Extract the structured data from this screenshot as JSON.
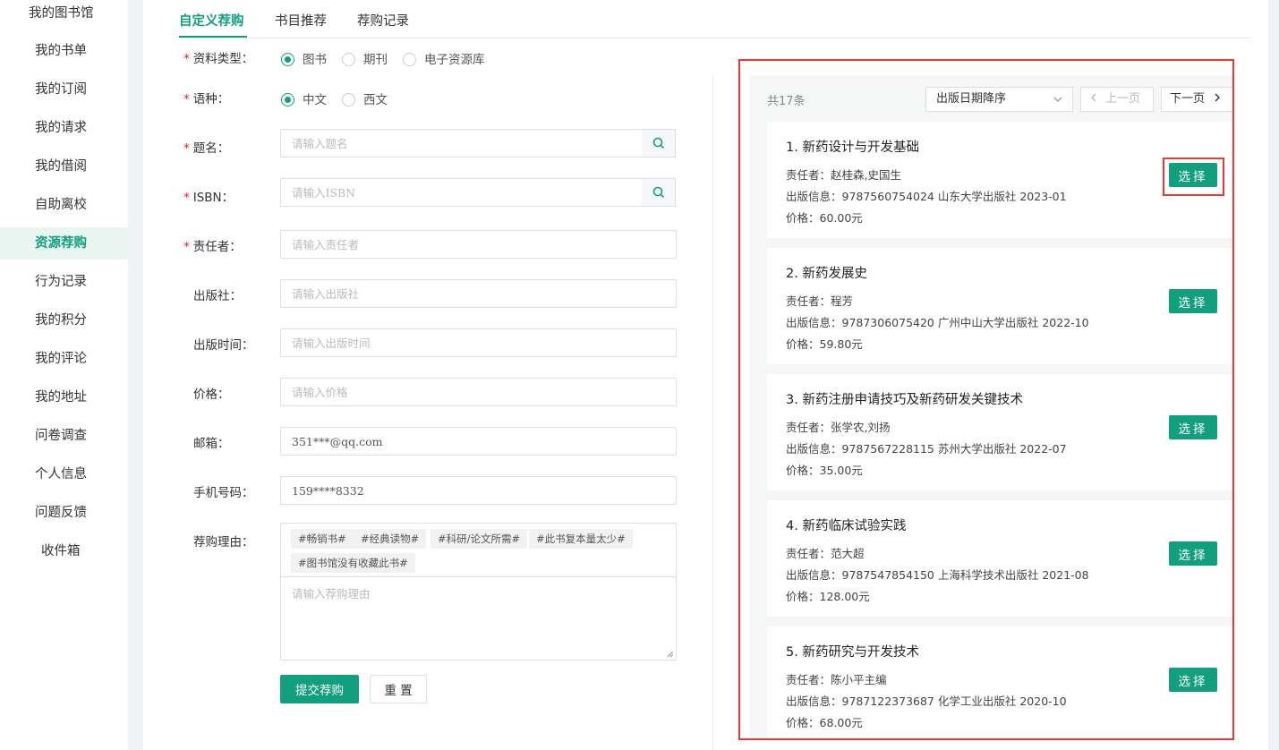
{
  "sidebar": {
    "items": [
      {
        "label": "我的图书馆",
        "active": false
      },
      {
        "label": "我的书单",
        "active": false
      },
      {
        "label": "我的订阅",
        "active": false
      },
      {
        "label": "我的请求",
        "active": false
      },
      {
        "label": "我的借阅",
        "active": false
      },
      {
        "label": "自助离校",
        "active": false
      },
      {
        "label": "资源荐购",
        "active": true
      },
      {
        "label": "行为记录",
        "active": false
      },
      {
        "label": "我的积分",
        "active": false
      },
      {
        "label": "我的评论",
        "active": false
      },
      {
        "label": "我的地址",
        "active": false
      },
      {
        "label": "问卷调查",
        "active": false
      },
      {
        "label": "个人信息",
        "active": false
      },
      {
        "label": "问题反馈",
        "active": false
      },
      {
        "label": "收件箱",
        "active": false
      }
    ]
  },
  "tabs": [
    {
      "label": "自定义荐购",
      "active": true
    },
    {
      "label": "书目推荐",
      "active": false
    },
    {
      "label": "荐购记录",
      "active": false
    }
  ],
  "form": {
    "material_type": {
      "label": "资料类型",
      "options": [
        "图书",
        "期刊",
        "电子资源库"
      ],
      "selected": "图书"
    },
    "language": {
      "label": "语种",
      "options": [
        "中文",
        "西文"
      ],
      "selected": "中文"
    },
    "title": {
      "label": "题名",
      "placeholder": "请输入题名",
      "value": ""
    },
    "isbn": {
      "label": "ISBN",
      "placeholder": "请输入ISBN",
      "value": ""
    },
    "author": {
      "label": "责任者",
      "placeholder": "请输入责任者",
      "value": ""
    },
    "publisher": {
      "label": "出版社",
      "placeholder": "请输入出版社",
      "value": ""
    },
    "pub_date": {
      "label": "出版时间",
      "placeholder": "请输入出版时间",
      "value": ""
    },
    "price": {
      "label": "价格",
      "placeholder": "请输入价格",
      "value": ""
    },
    "email": {
      "label": "邮箱",
      "placeholder": "",
      "value": "351***@qq.com"
    },
    "phone": {
      "label": "手机号码",
      "placeholder": "",
      "value": "159****8332"
    },
    "reason": {
      "label": "荐购理由",
      "tags": [
        "#畅销书#",
        "#经典读物#",
        "#科研/论文所需#",
        "#此书复本量太少#",
        "#图书馆没有收藏此书#"
      ],
      "placeholder": "请输入荐购理由"
    },
    "submit_label": "提交荐购",
    "reset_label": "重 置"
  },
  "results": {
    "count_text": "共17条",
    "sort_label": "出版日期降序",
    "prev_label": "上一页",
    "next_label": "下一页",
    "select_label": "选择",
    "items": [
      {
        "title": "1. 新药设计与开发基础",
        "author": "责任者：赵桂森,史国生",
        "pubinfo": "出版信息：9787560754024  山东大学出版社  2023-01",
        "price": "价格：60.00元"
      },
      {
        "title": "2. 新药发展史",
        "author": "责任者：程芳",
        "pubinfo": "出版信息：9787306075420  广州中山大学出版社  2022-10",
        "price": "价格：59.80元"
      },
      {
        "title": "3. 新药注册申请技巧及新药研发关键技术",
        "author": "责任者：张学农,刘扬",
        "pubinfo": "出版信息：9787567228115  苏州大学出版社  2022-07",
        "price": "价格：35.00元"
      },
      {
        "title": "4. 新药临床试验实践",
        "author": "责任者：范大超",
        "pubinfo": "出版信息：9787547854150  上海科学技术出版社  2021-08",
        "price": "价格：128.00元"
      },
      {
        "title": "5. 新药研究与开发技术",
        "author": "责任者：陈小平主编",
        "pubinfo": "出版信息：9787122373687  化学工业出版社  2020-10",
        "price": "价格：68.00元"
      }
    ]
  },
  "colors": {
    "accent": "#129f7e",
    "highlight": "#e53935"
  }
}
